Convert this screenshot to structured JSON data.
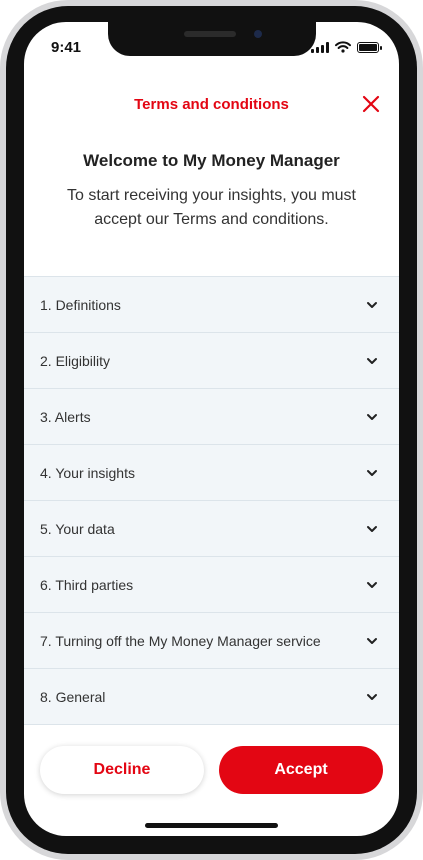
{
  "status_bar": {
    "time": "9:41",
    "icons": [
      "signal-icon",
      "wifi-icon",
      "battery-icon"
    ]
  },
  "header": {
    "title": "Terms and conditions",
    "close_icon": "close-icon"
  },
  "intro": {
    "title": "Welcome to My Money Manager",
    "text": "To start receiving your insights, you must accept our Terms and conditions."
  },
  "sections": [
    {
      "label": "1. Definitions"
    },
    {
      "label": "2. Eligibility"
    },
    {
      "label": "3. Alerts"
    },
    {
      "label": "4. Your insights"
    },
    {
      "label": "5. Your data"
    },
    {
      "label": "6. Third parties"
    },
    {
      "label": "7. Turning off the My Money Manager service"
    },
    {
      "label": "8. General"
    }
  ],
  "actions": {
    "decline_label": "Decline",
    "accept_label": "Accept"
  },
  "colors": {
    "brand_red": "#e30613",
    "row_background": "#f2f6f9",
    "divider": "#dce4ea"
  }
}
